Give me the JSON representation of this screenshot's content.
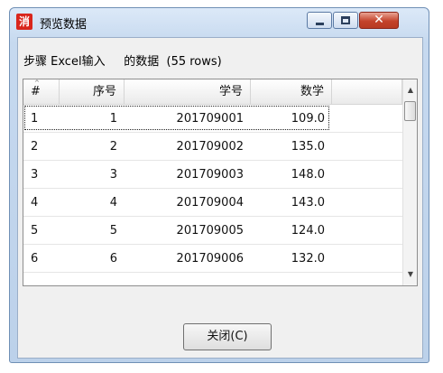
{
  "window": {
    "icon_glyph": "消",
    "title": "预览数据",
    "accent_color": "#c4432b"
  },
  "caption": "步骤 Excel输入     的数据  (55 rows)",
  "table": {
    "sort_indicator": "^",
    "columns": [
      "#",
      "序号",
      "学号",
      "数学"
    ],
    "rows": [
      [
        "1",
        "1",
        "201709001",
        "109.0"
      ],
      [
        "2",
        "2",
        "201709002",
        "135.0"
      ],
      [
        "3",
        "3",
        "201709003",
        "148.0"
      ],
      [
        "4",
        "4",
        "201709004",
        "143.0"
      ],
      [
        "5",
        "5",
        "201709005",
        "124.0"
      ],
      [
        "6",
        "6",
        "201709006",
        "132.0"
      ]
    ]
  },
  "buttons": {
    "close_label": "关闭(C)"
  },
  "icons": {
    "minimize": "minimize-icon",
    "maximize": "maximize-icon",
    "close": "close-icon",
    "scroll_up": "chevron-up-icon",
    "scroll_down": "chevron-down-icon"
  }
}
